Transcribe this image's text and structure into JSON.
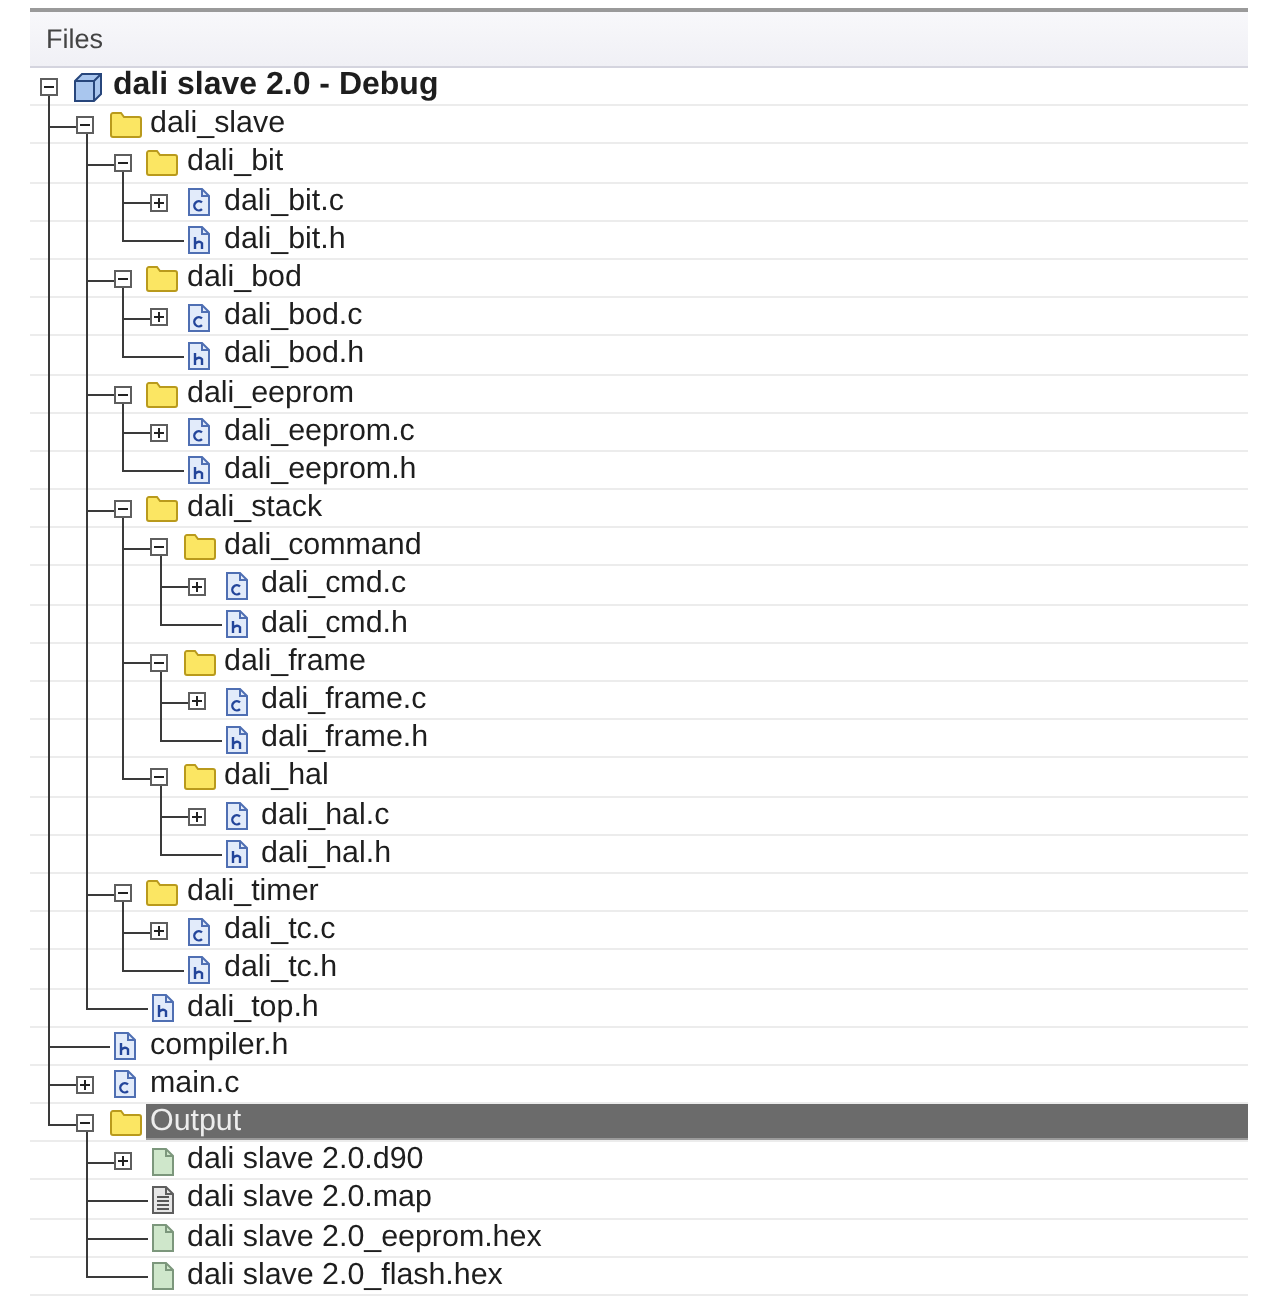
{
  "panel": {
    "title": "Files"
  },
  "tree": [
    {
      "label": "dali slave 2.0 - Debug",
      "kind": "project",
      "expanded": true,
      "selected": false,
      "children": [
        {
          "label": "dali_slave",
          "kind": "folder",
          "expanded": true,
          "selected": false,
          "children": [
            {
              "label": "dali_bit",
              "kind": "folder",
              "expanded": true,
              "selected": false,
              "children": [
                {
                  "label": "dali_bit.c",
                  "kind": "c_file",
                  "expanded": false,
                  "selected": false
                },
                {
                  "label": "dali_bit.h",
                  "kind": "h_file",
                  "selected": false
                }
              ]
            },
            {
              "label": "dali_bod",
              "kind": "folder",
              "expanded": true,
              "selected": false,
              "children": [
                {
                  "label": "dali_bod.c",
                  "kind": "c_file",
                  "expanded": false,
                  "selected": false
                },
                {
                  "label": "dali_bod.h",
                  "kind": "h_file",
                  "selected": false
                }
              ]
            },
            {
              "label": "dali_eeprom",
              "kind": "folder",
              "expanded": true,
              "selected": false,
              "children": [
                {
                  "label": "dali_eeprom.c",
                  "kind": "c_file",
                  "expanded": false,
                  "selected": false
                },
                {
                  "label": "dali_eeprom.h",
                  "kind": "h_file",
                  "selected": false
                }
              ]
            },
            {
              "label": "dali_stack",
              "kind": "folder",
              "expanded": true,
              "selected": false,
              "children": [
                {
                  "label": "dali_command",
                  "kind": "folder",
                  "expanded": true,
                  "selected": false,
                  "children": [
                    {
                      "label": "dali_cmd.c",
                      "kind": "c_file",
                      "expanded": false,
                      "selected": false
                    },
                    {
                      "label": "dali_cmd.h",
                      "kind": "h_file",
                      "selected": false
                    }
                  ]
                },
                {
                  "label": "dali_frame",
                  "kind": "folder",
                  "expanded": true,
                  "selected": false,
                  "children": [
                    {
                      "label": "dali_frame.c",
                      "kind": "c_file",
                      "expanded": false,
                      "selected": false
                    },
                    {
                      "label": "dali_frame.h",
                      "kind": "h_file",
                      "selected": false
                    }
                  ]
                },
                {
                  "label": "dali_hal",
                  "kind": "folder",
                  "expanded": true,
                  "selected": false,
                  "children": [
                    {
                      "label": "dali_hal.c",
                      "kind": "c_file",
                      "expanded": false,
                      "selected": false
                    },
                    {
                      "label": "dali_hal.h",
                      "kind": "h_file",
                      "selected": false
                    }
                  ]
                }
              ]
            },
            {
              "label": "dali_timer",
              "kind": "folder",
              "expanded": true,
              "selected": false,
              "children": [
                {
                  "label": "dali_tc.c",
                  "kind": "c_file",
                  "expanded": false,
                  "selected": false
                },
                {
                  "label": "dali_tc.h",
                  "kind": "h_file",
                  "selected": false
                }
              ]
            },
            {
              "label": "dali_top.h",
              "kind": "h_file",
              "selected": false
            }
          ]
        },
        {
          "label": "compiler.h",
          "kind": "h_file",
          "selected": false
        },
        {
          "label": "main.c",
          "kind": "c_file",
          "expanded": false,
          "selected": false
        },
        {
          "label": "Output",
          "kind": "folder",
          "expanded": true,
          "selected": true,
          "children": [
            {
              "label": "dali slave 2.0.d90",
              "kind": "output_file",
              "expanded": false,
              "selected": false
            },
            {
              "label": "dali slave 2.0.map",
              "kind": "map_file",
              "selected": false
            },
            {
              "label": "dali slave 2.0_eeprom.hex",
              "kind": "output_file",
              "selected": false
            },
            {
              "label": "dali slave 2.0_flash.hex",
              "kind": "output_file",
              "selected": false
            }
          ]
        }
      ]
    }
  ]
}
